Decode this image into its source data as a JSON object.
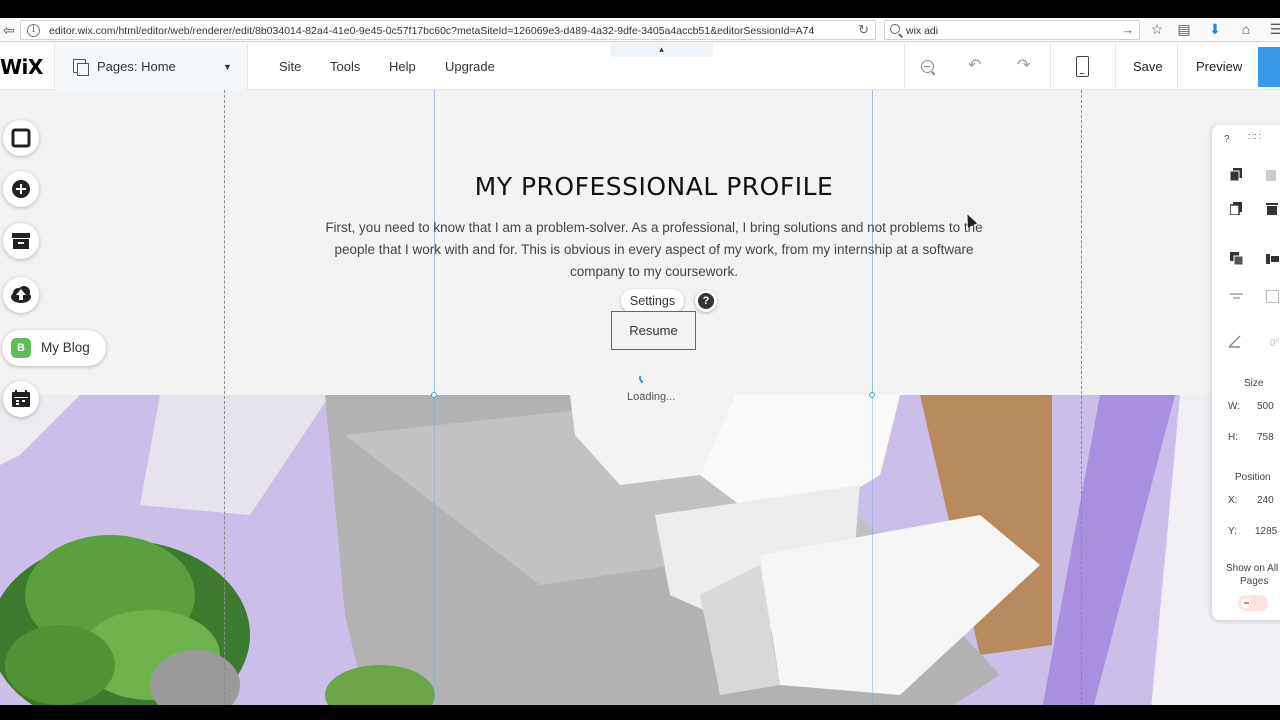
{
  "browser": {
    "url": "editor.wix.com/html/editor/web/renderer/edit/8b034014-82a4-41e0-9e45-0c57f17bc60c?metaSiteId=126069e3-d489-4a32-9dfe-3405a4accb51&editorSessionId=A74",
    "search_value": "wix adi"
  },
  "editor": {
    "logo": "WiX",
    "pages_label": "Pages: Home",
    "menu": [
      "Site",
      "Tools",
      "Help",
      "Upgrade"
    ],
    "save_label": "Save",
    "preview_label": "Preview"
  },
  "content": {
    "title": "MY PROFESSIONAL PROFILE",
    "body": "First, you need to know that I am a problem-solver. As a professional, I bring solutions and not problems to the people that I work with and for. This is obvious in every aspect of my work, from my internship at a software company to my coursework.",
    "settings_label": "Settings",
    "help_glyph": "?",
    "resume_label": "Resume",
    "loading_label": "Loading..."
  },
  "left_tools": {
    "blog_badge": "B",
    "blog_label": "My Blog"
  },
  "right_panel": {
    "help": "?",
    "size_label": "Size",
    "w_label": "W:",
    "w_value": "500",
    "h_label": "H:",
    "h_value": "758",
    "position_label": "Position",
    "x_label": "X:",
    "x_value": "240",
    "y_label": "Y:",
    "y_value": "1285",
    "rotation_value": "0°",
    "show_all_label": "Show on All",
    "pages_label": "Pages"
  }
}
